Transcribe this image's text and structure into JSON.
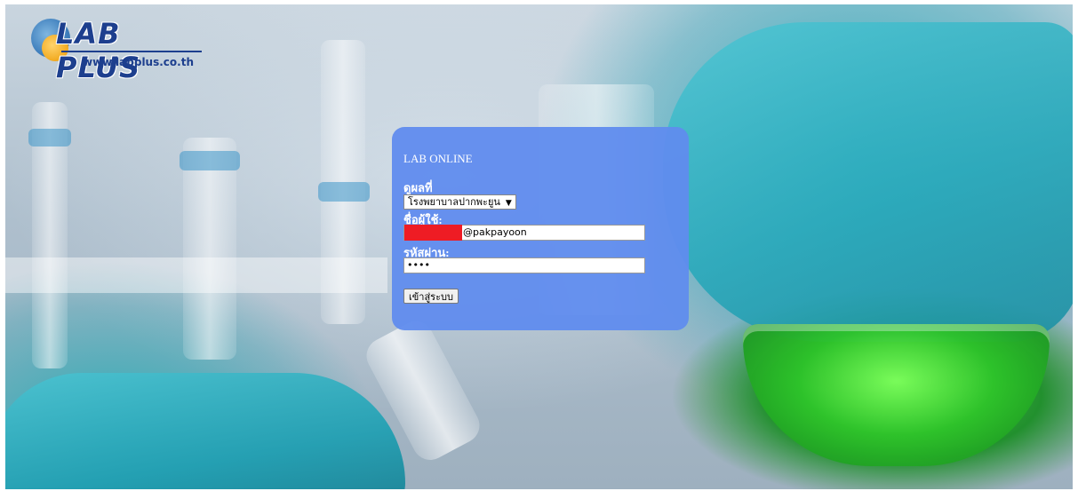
{
  "logo": {
    "brand": "LAB PLUS",
    "url_text": "www.labplus.co.th"
  },
  "login": {
    "title": "LAB ONLINE",
    "view_results_label": "ดูผลที่",
    "hospital_selected": "โรงพยาบาลปากพะยูน",
    "username_label": "ชื่อผู้ใช้:",
    "username_visible_suffix": "@pakpayoon",
    "password_label": "รหัสผ่าน:",
    "password_masked": "••••",
    "submit_label": "เข้าสู่ระบบ"
  },
  "colors": {
    "panel": "#608CEE",
    "redaction": "#EE1C24",
    "logo_blue": "#1D3F8E"
  },
  "icons": {
    "dropdown_arrow": "chevron-down-icon"
  }
}
